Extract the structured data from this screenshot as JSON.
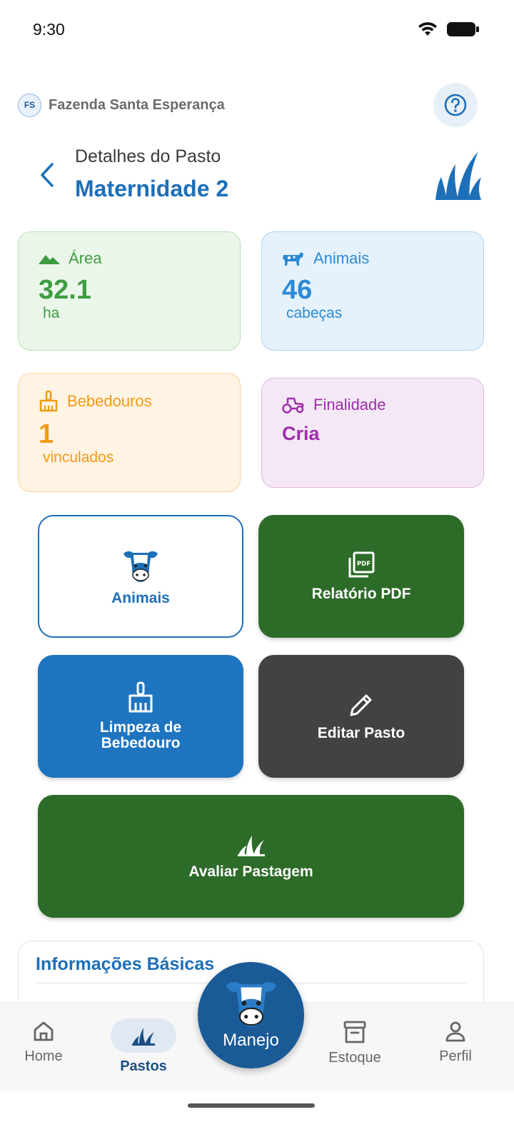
{
  "status_bar": {
    "time": "9:30"
  },
  "header": {
    "farm_initials": "FS",
    "farm_name": "Fazenda Santa Esperança",
    "subtitle": "Detalhes do Pasto",
    "title": "Maternidade 2"
  },
  "stats": {
    "area": {
      "label": "Área",
      "value": "32.1",
      "unit": "ha"
    },
    "animals": {
      "label": "Animais",
      "value": "46",
      "unit": "cabeças"
    },
    "bebedouros": {
      "label": "Bebedouros",
      "value": "1",
      "unit": "vinculados"
    },
    "finalidade": {
      "label": "Finalidade",
      "value": "Cria"
    }
  },
  "actions": {
    "animais": "Animais",
    "relatorio_pdf": "Relatório PDF",
    "limpeza_line1": "Limpeza de",
    "limpeza_line2": "Bebedouro",
    "editar": "Editar Pasto",
    "avaliar": "Avaliar Pastagem"
  },
  "info": {
    "title": "Informações Básicas"
  },
  "nav": {
    "home": "Home",
    "pastos": "Pastos",
    "manejo": "Manejo",
    "estoque": "Estoque",
    "perfil": "Perfil"
  },
  "colors": {
    "primary": "#1d6fb8",
    "green_button": "#2d6b28",
    "dark_button": "#424245",
    "area": "#3e9c42",
    "animals": "#2c8ad6",
    "bebedouros": "#f29a16",
    "finalidade": "#9d2eaa"
  }
}
